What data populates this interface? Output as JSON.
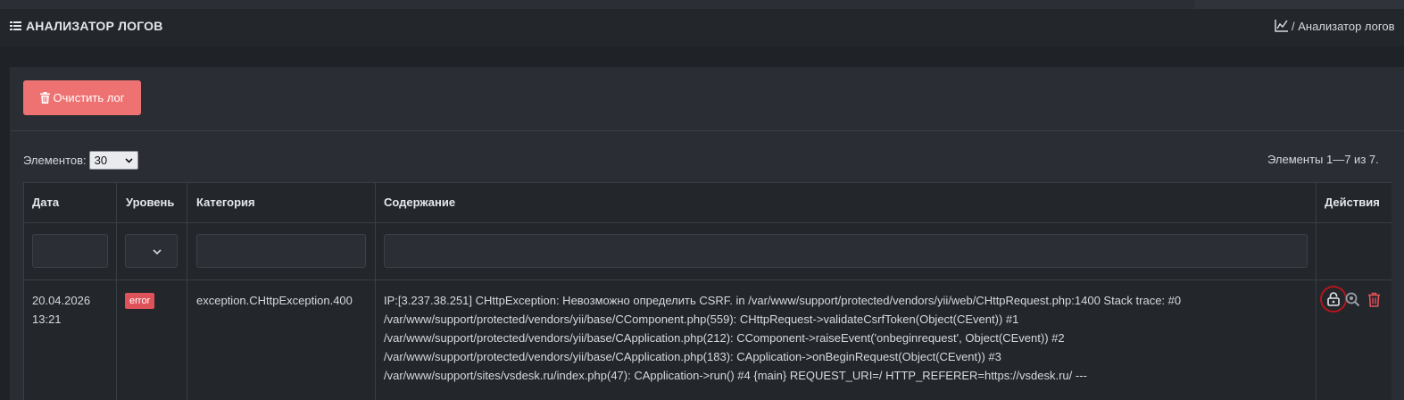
{
  "header": {
    "title": "АНАЛИЗАТОР ЛОГОВ",
    "breadcrumb": "/ Анализатор логов",
    "breadcrumb_icon": "chart-icon"
  },
  "toolbar": {
    "clear_label": "Очистить лог",
    "clear_icon": "trash-icon",
    "clear_color": "#ef7272"
  },
  "pager": {
    "per_page_label": "Элементов:",
    "per_page_value": "30",
    "summary": "Элементы 1—7 из 7."
  },
  "table": {
    "columns": [
      "Дата",
      "Уровень",
      "Категория",
      "Содержание",
      "Действия"
    ],
    "rows": [
      {
        "date_line1": "20.04.2026",
        "date_line2": "13:21",
        "level": "error",
        "level_color": "#e0525a",
        "category": "exception.CHttpException.400",
        "content": [
          "IP:[3.237.38.251] CHttpException: Невозможно определить CSRF. in /var/www/support/protected/vendors/yii/web/CHttpRequest.php:1400 Stack trace: #0",
          "/var/www/support/protected/vendors/yii/base/CComponent.php(559): CHttpRequest->validateCsrfToken(Object(CEvent)) #1",
          "/var/www/support/protected/vendors/yii/base/CApplication.php(212): CComponent->raiseEvent('onbeginrequest', Object(CEvent)) #2",
          "/var/www/support/protected/vendors/yii/base/CApplication.php(183): CApplication->onBeginRequest(Object(CEvent)) #3",
          "/var/www/support/sites/vsdesk.ru/index.php(47): CApplication->run() #4 {main} REQUEST_URI=/ HTTP_REFERER=https://vsdesk.ru/ ---"
        ],
        "actions": [
          "lock-icon",
          "zoom-icon",
          "trash-icon"
        ]
      }
    ]
  }
}
